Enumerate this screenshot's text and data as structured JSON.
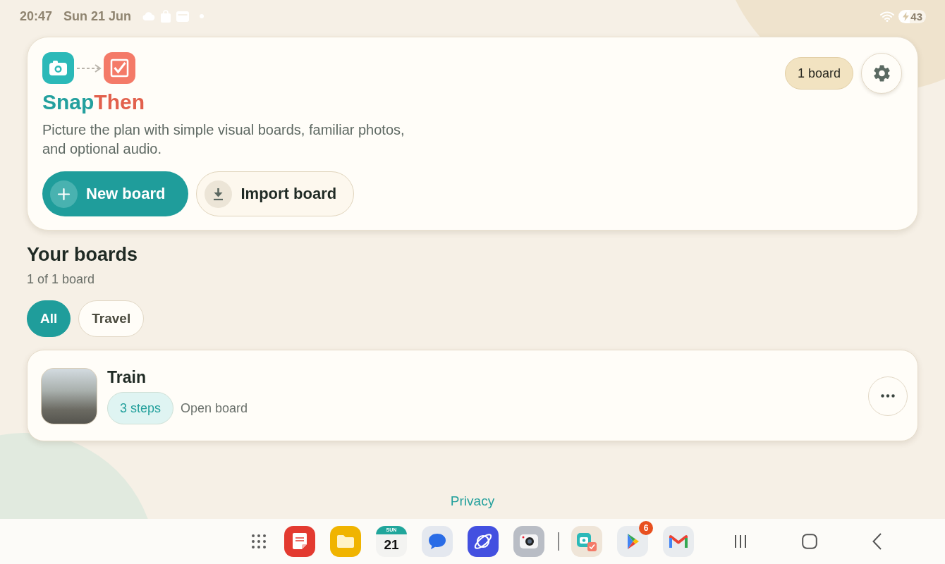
{
  "status_bar": {
    "time": "20:47",
    "date": "Sun 21 Jun",
    "battery": "43"
  },
  "header": {
    "title_parts": [
      {
        "text": "Snap",
        "color": "#23a09e"
      },
      {
        "text": "Then",
        "color": "#e2604c"
      }
    ],
    "description": "Picture the plan with simple visual boards, familiar photos, and optional audio.",
    "board_count": "1 board",
    "buttons": [
      {
        "label": "New board",
        "kind": "primary"
      },
      {
        "label": "Import board",
        "kind": "secondary"
      }
    ]
  },
  "section": {
    "title": "Your boards",
    "subtitle": "1 of 1 board"
  },
  "filters": [
    {
      "label": "All",
      "selected": true
    },
    {
      "label": "Travel",
      "selected": false
    }
  ],
  "boards": [
    {
      "title": "Train",
      "steps": "3 steps",
      "action": "Open board"
    }
  ],
  "footer": {
    "link": "Privacy"
  },
  "dock": {
    "calendar_weekday": "SUN",
    "calendar_day": "21",
    "store_badge": "6"
  }
}
